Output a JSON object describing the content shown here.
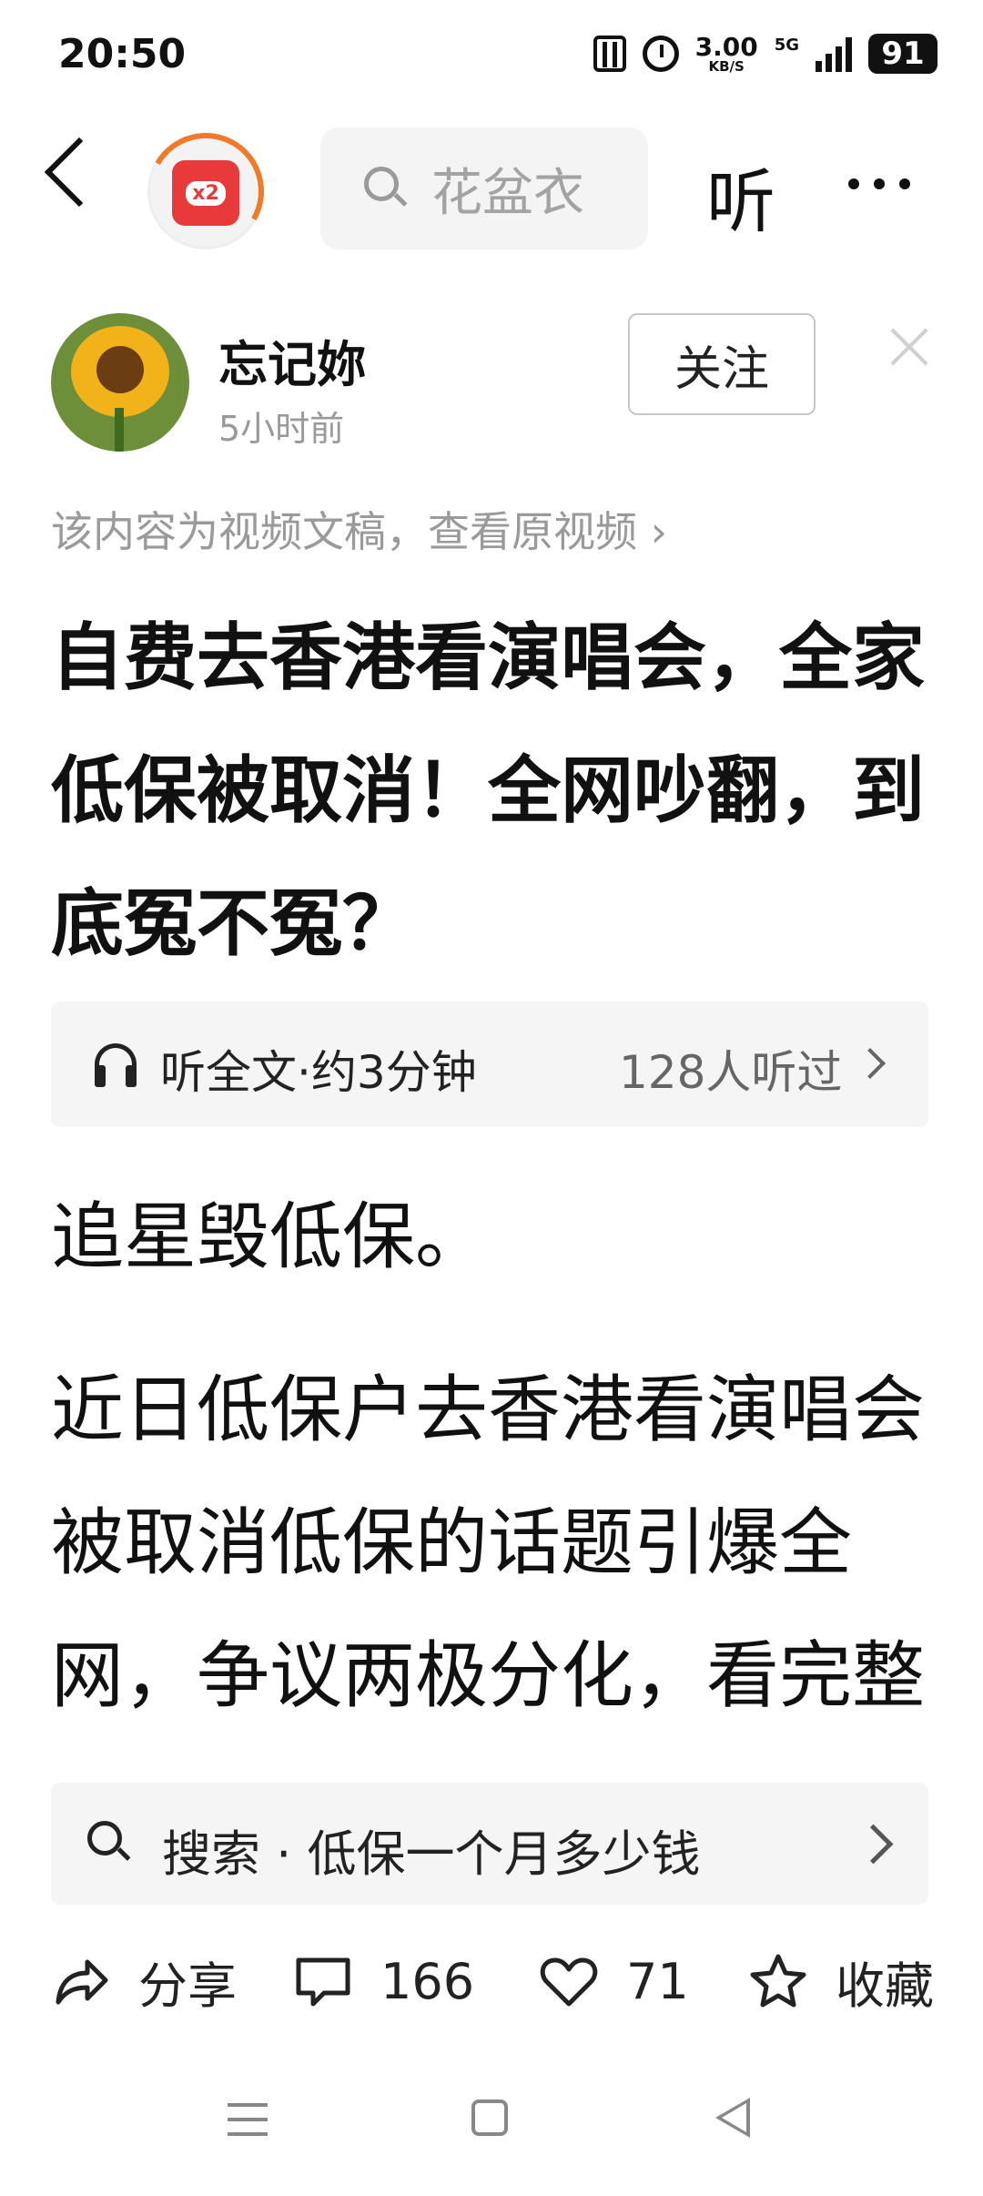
{
  "status_bar": {
    "time": "20:50",
    "net_speed_value": "3.00",
    "net_speed_unit": "KB/S",
    "network": "5G",
    "battery": "91"
  },
  "header": {
    "search_placeholder": "花盆衣",
    "listen_label": "听"
  },
  "author": {
    "name": "忘记妳",
    "time": "5小时前",
    "follow_label": "关注"
  },
  "video_note": "该内容为视频文稿，查看原视频 ›",
  "article": {
    "title": "自费去香港看演唱会，全家低保被取消！全网吵翻，到底冤不冤？",
    "listen_label": "听全文·约3分钟",
    "listened_count": "128人听过",
    "paragraphs": [
      "追星毁低保。",
      "近日低保户去香港看演唱会被取消低保的话题引爆全网，争议两极分化，看完整件事的来龙"
    ]
  },
  "suggestion": {
    "text": "搜索 · 低保一个月多少钱"
  },
  "actions": {
    "share_label": "分享",
    "comment_count": "166",
    "like_count": "71",
    "favorite_label": "收藏"
  },
  "colors": {
    "accent_red": "#e83a3a",
    "ring_orange": "#f07a2a",
    "muted_text": "#9a9a9a"
  }
}
